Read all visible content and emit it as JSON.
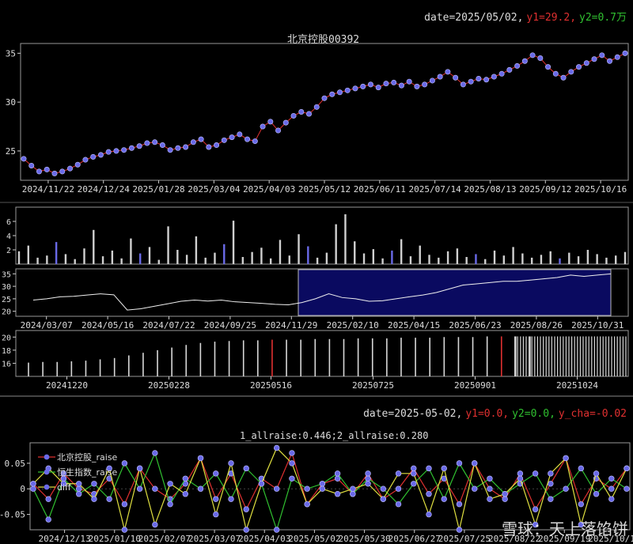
{
  "top_header": {
    "date": "date=2025/05/02,",
    "y1": "y1=29.2,",
    "y2": "y2=0.7万"
  },
  "bottom_header": {
    "date": "date=2025-05-02,",
    "y1": "y1=0.0,",
    "y2": "y2=0.0,",
    "ycha": "y_cha=-0.02"
  },
  "colors": {
    "line": "#e03030",
    "marker": "#6a6ae8",
    "green": "#30c030",
    "yellow": "#e0e040",
    "red": "#e03030",
    "blue": "#6a6ae8",
    "nav": "#0a0a60"
  },
  "watermark": "雪球：天上落馅饼",
  "chart_data": [
    {
      "type": "line",
      "title": "北京控股00392",
      "x_ticks": [
        "2024/11/22",
        "2024/12/24",
        "2025/01/28",
        "2025/03/04",
        "2025/04/03",
        "2025/05/12",
        "2025/06/11",
        "2025/07/14",
        "2025/08/13",
        "2025/09/12",
        "2025/10/16"
      ],
      "ylim": [
        22,
        36
      ],
      "y_ticks": [
        "25",
        "30",
        "35"
      ],
      "values": [
        24.2,
        23.5,
        22.9,
        23.1,
        22.7,
        22.9,
        23.2,
        23.6,
        24.1,
        24.4,
        24.6,
        24.9,
        25.0,
        25.1,
        25.3,
        25.5,
        25.8,
        25.9,
        25.6,
        25.1,
        25.3,
        25.4,
        25.9,
        26.2,
        25.4,
        25.6,
        26.1,
        26.4,
        26.7,
        26.2,
        26.0,
        27.5,
        28.0,
        27.1,
        27.9,
        28.6,
        29.0,
        28.8,
        29.5,
        30.4,
        30.8,
        31.0,
        31.2,
        31.4,
        31.6,
        31.8,
        31.5,
        31.9,
        32.0,
        31.7,
        32.1,
        31.6,
        31.8,
        32.2,
        32.6,
        33.1,
        32.5,
        31.8,
        32.1,
        32.4,
        32.3,
        32.6,
        32.9,
        33.3,
        33.7,
        34.2,
        34.8,
        34.5,
        33.6,
        32.9,
        32.5,
        33.1,
        33.6,
        34.0,
        34.4,
        34.8,
        34.2,
        34.6,
        35.0
      ]
    },
    {
      "type": "bar",
      "title": "",
      "ylim": [
        0,
        8
      ],
      "y_ticks": [
        "2",
        "4",
        "6"
      ],
      "values": [
        1.8,
        2.6,
        0.9,
        1.2,
        3.1,
        1.4,
        0.7,
        2.2,
        4.8,
        1.1,
        1.9,
        0.8,
        3.6,
        1.5,
        2.4,
        0.6,
        5.3,
        2.0,
        1.3,
        3.9,
        0.9,
        1.6,
        2.8,
        6.1,
        1.0,
        1.7,
        2.3,
        0.8,
        3.4,
        1.2,
        4.2,
        2.5,
        0.9,
        1.6,
        5.6,
        7.0,
        3.2,
        1.5,
        2.1,
        0.8,
        1.9,
        3.5,
        1.1,
        2.6,
        1.3,
        0.9,
        1.8,
        2.2,
        1.0,
        1.4,
        0.7,
        1.9,
        1.2,
        2.4,
        1.5,
        0.9,
        1.3,
        1.8,
        0.8,
        1.6,
        1.1,
        2.0,
        1.4,
        0.9,
        1.2,
        1.7
      ]
    },
    {
      "type": "area",
      "title": "",
      "x_ticks": [
        "2024/03/07",
        "2024/05/16",
        "2024/07/22",
        "2024/09/25",
        "2024/11/29",
        "2025/02/10",
        "2025/04/15",
        "2025/06/23",
        "2025/08/26",
        "2025/10/31"
      ],
      "ylim": [
        18,
        37
      ],
      "y_ticks": [
        "20",
        "25",
        "30",
        "35"
      ],
      "values": [
        24.5,
        25.0,
        25.8,
        26.0,
        26.5,
        27.0,
        26.6,
        20.5,
        21.0,
        22.0,
        23.0,
        24.0,
        24.5,
        24.1,
        24.5,
        23.8,
        23.5,
        23.2,
        22.8,
        22.6,
        23.5,
        25.0,
        27.0,
        25.5,
        25.0,
        24.0,
        24.2,
        25.0,
        25.8,
        26.5,
        27.5,
        29.0,
        30.5,
        31.0,
        31.5,
        32.0,
        32.0,
        32.5,
        33.0,
        33.5,
        34.5,
        34.0,
        34.5,
        35.0
      ]
    },
    {
      "type": "bar",
      "title": "",
      "x_ticks": [
        "20241220",
        "20250228",
        "20250516",
        "20250725",
        "20250901",
        "20251024"
      ],
      "ylim": [
        14,
        21
      ],
      "y_ticks": [
        "16",
        "18",
        "20"
      ],
      "values": [
        16.1,
        16.2,
        16.2,
        16.3,
        16.4,
        16.6,
        16.8,
        17.2,
        17.6,
        18.0,
        18.4,
        18.8,
        19.1,
        19.3,
        19.4,
        19.5,
        19.5,
        19.6,
        19.6,
        19.6,
        19.7,
        19.7,
        19.7,
        19.8,
        19.8,
        19.8,
        19.9,
        19.9,
        19.9,
        20.0,
        20.0,
        20.0,
        20.1,
        20.1,
        20.1,
        20.1
      ]
    },
    {
      "type": "line",
      "title": "1_allraise:0.446;2_allraise:0.280",
      "x_ticks": [
        "2024/12/13",
        "2025/01/10",
        "2025/02/07",
        "2025/03/07",
        "2025/04/03",
        "2025/05/02",
        "2025/05/30",
        "2025/06/27",
        "2025/07/25",
        "2025/08/22",
        "2025/09/19",
        "2025/10/17"
      ],
      "ylim": [
        -0.08,
        0.09
      ],
      "y_ticks": [
        "0.05",
        "0",
        "-0.05"
      ],
      "legend": [
        "北京控股_raise",
        "恒生指数_raise",
        "diff"
      ],
      "series": [
        {
          "name": "北京控股_raise",
          "color": "#e03030",
          "values": [
            0.01,
            -0.02,
            0.03,
            0.0,
            -0.01,
            0.02,
            -0.03,
            0.04,
            0.0,
            -0.02,
            0.01,
            0.06,
            -0.02,
            0.03,
            -0.04,
            0.02,
            0.0,
            0.07,
            -0.03,
            0.01,
            0.02,
            -0.01,
            0.03,
            -0.02,
            0.0,
            0.04,
            -0.01,
            0.02,
            -0.03,
            0.05,
            0.0,
            -0.02,
            0.03,
            -0.04,
            0.01,
            0.06,
            -0.03,
            0.02,
            0.0,
            0.04
          ]
        },
        {
          "name": "恒生指数_raise",
          "color": "#30c030",
          "values": [
            0.0,
            -0.06,
            0.02,
            -0.01,
            0.01,
            -0.02,
            0.05,
            0.0,
            0.07,
            -0.03,
            0.02,
            0.0,
            0.03,
            -0.02,
            0.04,
            0.01,
            -0.08,
            0.02,
            0.0,
            0.01,
            0.03,
            -0.01,
            0.02,
            0.0,
            -0.03,
            0.01,
            0.04,
            -0.02,
            0.05,
            0.0,
            0.02,
            -0.01,
            0.01,
            0.03,
            -0.02,
            0.0,
            0.04,
            -0.01,
            0.02,
            0.0
          ]
        },
        {
          "name": "diff",
          "color": "#e0e040",
          "values": [
            0.01,
            0.04,
            0.01,
            0.01,
            -0.02,
            0.04,
            -0.08,
            0.04,
            -0.07,
            0.01,
            -0.01,
            0.06,
            -0.05,
            0.05,
            -0.08,
            0.01,
            0.08,
            0.05,
            -0.03,
            0.0,
            -0.01,
            0.0,
            0.01,
            -0.02,
            0.03,
            0.03,
            -0.05,
            0.04,
            -0.08,
            0.05,
            -0.02,
            -0.01,
            0.02,
            -0.07,
            0.03,
            0.06,
            -0.07,
            0.03,
            -0.02,
            0.04
          ]
        }
      ]
    }
  ]
}
